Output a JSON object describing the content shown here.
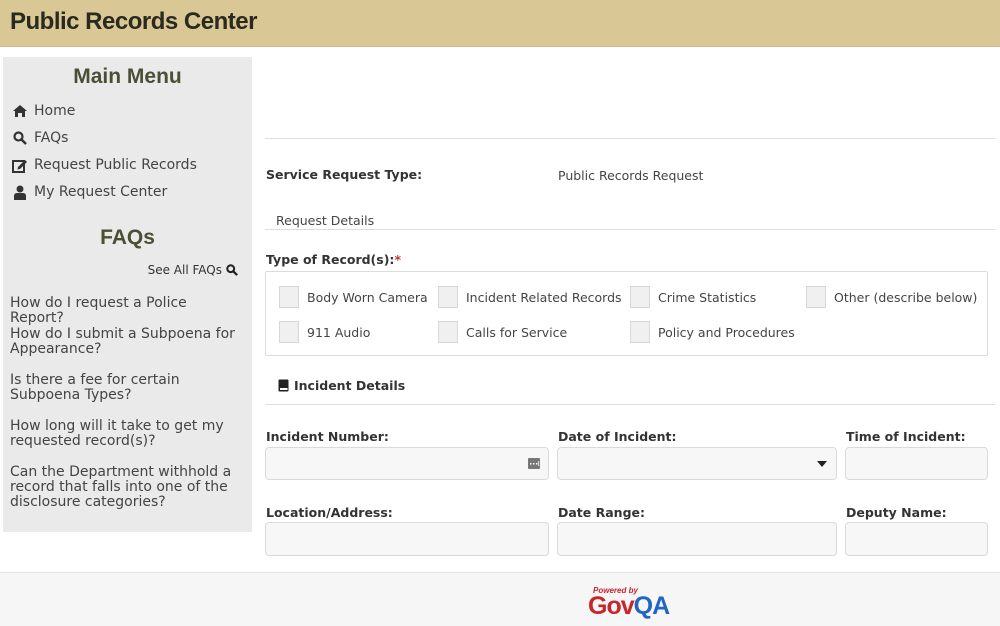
{
  "header": {
    "title": "Public Records Center"
  },
  "sidebar": {
    "main_menu_title": "Main Menu",
    "menu_items": [
      {
        "label": "Home",
        "icon": "home-icon"
      },
      {
        "label": "FAQs",
        "icon": "search-icon"
      },
      {
        "label": "Request Public Records",
        "icon": "edit-icon"
      },
      {
        "label": "My Request Center",
        "icon": "user-icon"
      }
    ],
    "faqs_title": "FAQs",
    "see_all_label": "See All FAQs",
    "faq_links": [
      "How do I request a Police Report?",
      "How do I submit a Subpoena for Appearance?",
      "Is there a fee for certain Subpoena Types?",
      "How long will it take to get my requested record(s)?",
      "Can the Department withhold a record that falls into one of the disclosure categories?"
    ]
  },
  "form": {
    "service_request_type_label": "Service Request Type:",
    "service_request_type_value": "Public Records Request",
    "request_details_heading": "Request Details",
    "type_of_records_label": "Type of Record(s):",
    "required_marker": "*",
    "record_types": [
      {
        "label": "Body Worn Camera",
        "checked": false
      },
      {
        "label": "Incident Related Records",
        "checked": false
      },
      {
        "label": "Crime Statistics",
        "checked": false
      },
      {
        "label": "Other (describe below)",
        "checked": false
      },
      {
        "label": "911 Audio",
        "checked": false
      },
      {
        "label": "Calls for Service",
        "checked": false
      },
      {
        "label": "Policy and Procedures",
        "checked": false
      }
    ],
    "incident_details_heading": "Incident Details",
    "fields": {
      "incident_number": {
        "label": "Incident Number:",
        "value": ""
      },
      "date_of_incident": {
        "label": "Date of Incident:",
        "value": ""
      },
      "time_of_incident": {
        "label": "Time of Incident:",
        "value": ""
      },
      "location_address": {
        "label": "Location/Address:",
        "value": ""
      },
      "date_range": {
        "label": "Date Range:",
        "value": ""
      },
      "deputy_name": {
        "label": "Deputy Name:",
        "value": ""
      }
    }
  },
  "footer": {
    "powered_by": "Powered by",
    "brand_gov": "Gov",
    "brand_qa": "QA"
  },
  "colors": {
    "header_bg": "#d9c795",
    "sidebar_bg": "#eaeaea",
    "heading_olive": "#4b4f33",
    "required_red": "#c0392b",
    "brand_red": "#c8262a",
    "brand_blue": "#2266c4"
  }
}
